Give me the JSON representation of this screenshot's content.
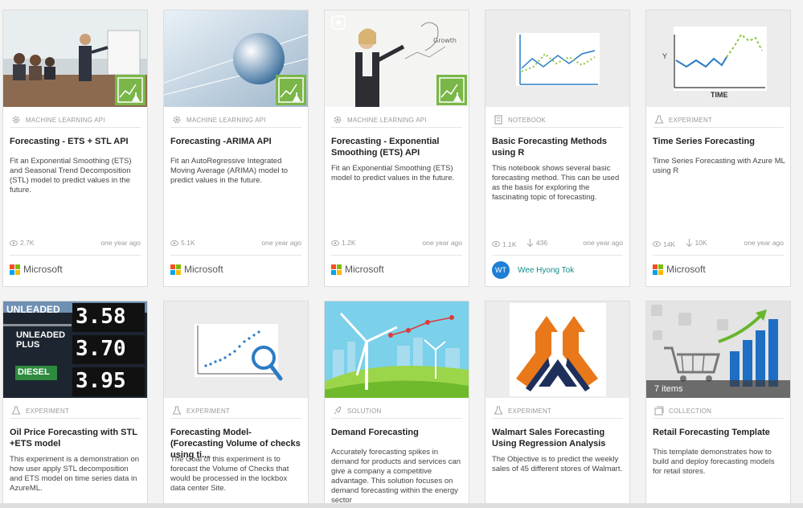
{
  "cards": [
    {
      "category": "MACHINE LEARNING API",
      "title": "Forecasting - ETS + STL API",
      "desc": "Fit an Exponential Smoothing (ETS) and Seasonal Trend Decomposition (STL) model to predict values in the future.",
      "views": "2.7K",
      "ago": "one year ago",
      "author": "Microsoft"
    },
    {
      "category": "MACHINE LEARNING API",
      "title": "Forecasting -ARIMA API",
      "desc": "Fit an AutoRegressive Integrated Moving Average (ARIMA) model to predict values in the future.",
      "views": "5.1K",
      "ago": "one year ago",
      "author": "Microsoft"
    },
    {
      "category": "MACHINE LEARNING API",
      "title": "Forecasting - Exponential Smoothing (ETS) API",
      "desc": "Fit an Exponential Smoothing (ETS) model to predict values in the future.",
      "views": "1.2K",
      "ago": "one year ago",
      "author": "Microsoft"
    },
    {
      "category": "NOTEBOOK",
      "title": "Basic Forecasting Methods using R",
      "desc": "This notebook shows several basic forecasting method. This can be used as the basis for exploring the fascinating topic of forecasting.",
      "views": "1.1K",
      "downloads": "436",
      "ago": "one year ago",
      "author": "Wee Hyong Tok",
      "initials": "WT"
    },
    {
      "category": "EXPERIMENT",
      "title": "Time Series Forecasting",
      "desc": "Time Series Forecasting with Azure ML using R",
      "views": "14K",
      "downloads": "10K",
      "ago": "one year ago",
      "author": "Microsoft",
      "chart_y": "Y",
      "chart_x": "TIME"
    },
    {
      "category": "EXPERIMENT",
      "title": "Oil Price Forecasting with STL +ETS model",
      "desc": "This experiment is a demonstration on how user apply STL decomposition and ETS model on time series data in AzureML.",
      "sign": [
        "UNLEADED",
        "3.58",
        "UNLEADED PLUS",
        "3.70",
        "DIESEL",
        "3.95"
      ]
    },
    {
      "category": "EXPERIMENT",
      "title": "Forecasting Model-(Forecasting Volume of checks using ti...",
      "desc": "The Goal of this experiment is to forecast the Volume of Checks that would be processed in the lockbox data center Site."
    },
    {
      "category": "SOLUTION",
      "title": "Demand Forecasting",
      "desc": "Accurately forecasting spikes in demand for products and services can give a company a competitive advantage. This solution focuses on demand forecasting within the energy sector"
    },
    {
      "category": "EXPERIMENT",
      "title": "Walmart Sales Forecasting Using Regression Analysis",
      "desc": "The Objective is to predict the weekly sales of 45 different stores of Walmart."
    },
    {
      "category": "COLLECTION",
      "title": "Retail Forecasting Template",
      "desc": "This template demonstrates how to build and deploy forecasting models for retail stores.",
      "items": "7 items"
    }
  ],
  "colors": {
    "green_badge": "#7ab648",
    "ms_red": "#f25022",
    "ms_green": "#7fba00",
    "ms_blue": "#00a4ef",
    "ms_yellow": "#ffb900",
    "link_teal": "#168a8a"
  }
}
